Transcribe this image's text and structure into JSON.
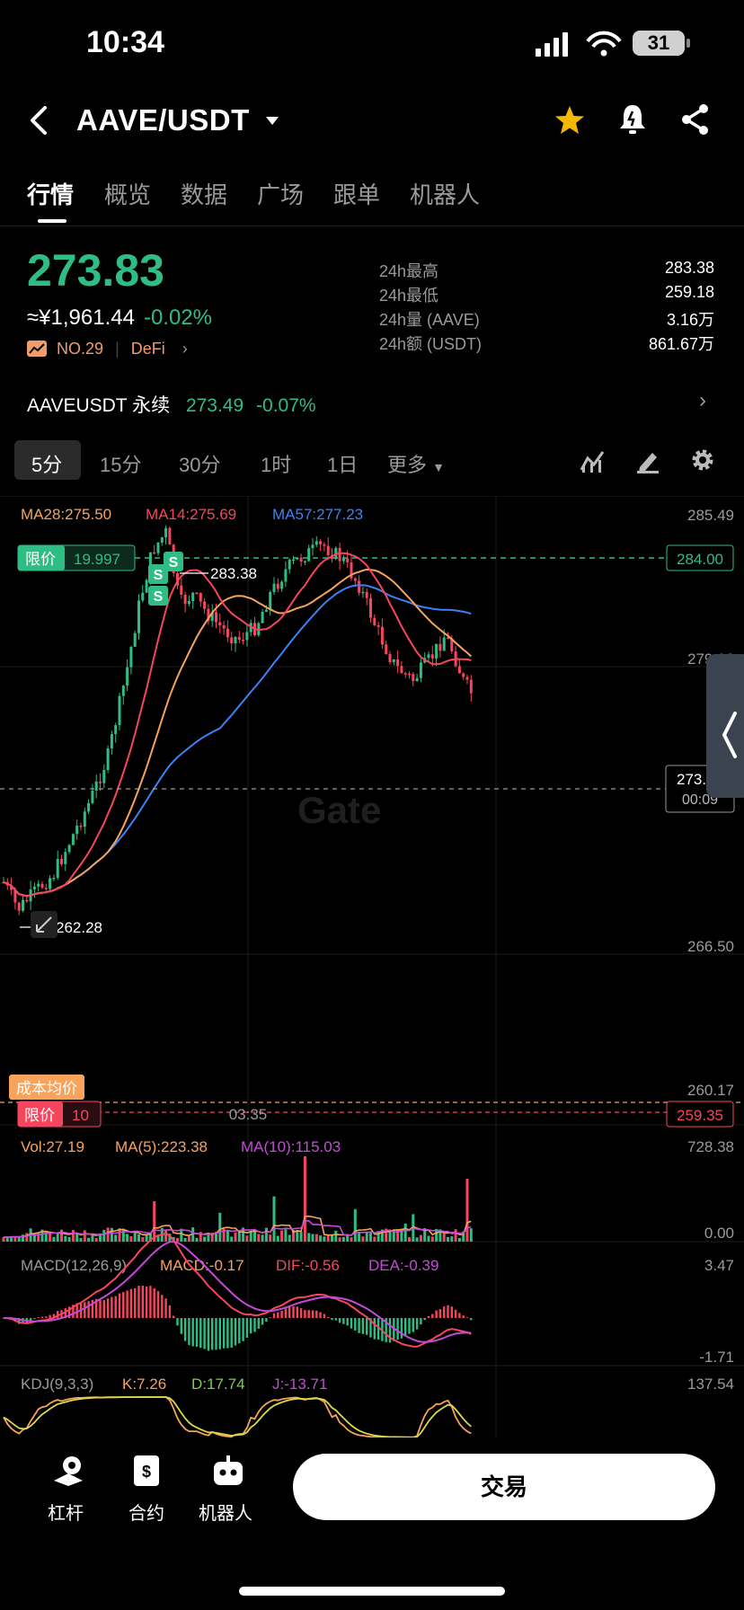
{
  "status": {
    "time": "10:34",
    "battery": "31"
  },
  "header": {
    "pair": "AAVE/USDT"
  },
  "tabs": [
    "行情",
    "概览",
    "数据",
    "广场",
    "跟单",
    "机器人"
  ],
  "ticker": {
    "price": "273.83",
    "cny": "≈¥1,961.44",
    "change": "-0.02%",
    "rank": "NO.29",
    "sector": "DeFi",
    "stats": [
      {
        "label": "24h最高",
        "value": "283.38"
      },
      {
        "label": "24h最低",
        "value": "259.18"
      },
      {
        "label": "24h量 (AAVE)",
        "value": "3.16万"
      },
      {
        "label": "24h额 (USDT)",
        "value": "861.67万"
      }
    ]
  },
  "perpetual": {
    "name": "AAVEUSDT 永续",
    "price": "273.49",
    "change": "-0.07%"
  },
  "intervals": [
    "5分",
    "15分",
    "30分",
    "1时",
    "1日",
    "更多"
  ],
  "main_chart": {
    "ma28": "MA28:275.50",
    "ma14": "MA14:275.69",
    "ma57": "MA57:277.23",
    "y_labels": [
      "285.49",
      "279.16",
      "266.50",
      "260.17"
    ],
    "limit_label": "限价",
    "limit_qty": "19.997",
    "limit_price": "284.00",
    "high_mark": "283.38",
    "low_mark": "262.28",
    "cur_price": "273.83",
    "countdown": "00:09",
    "cost_label": "成本均价",
    "limit2_label": "限价",
    "limit2_qty": "10",
    "limit2_price": "259.35",
    "x_label": "03:35",
    "marker": "S",
    "watermark": "Gate"
  },
  "vol_panel": {
    "vol": "Vol:27.19",
    "ma5": "MA(5):223.38",
    "ma10": "MA(10):115.03",
    "top": "728.38",
    "bottom": "0.00"
  },
  "macd_panel": {
    "title": "MACD(12,26,9)",
    "macd": "MACD:-0.17",
    "dif": "DIF:-0.56",
    "dea": "DEA:-0.39",
    "top": "3.47",
    "bottom": "-1.71"
  },
  "kdj_panel": {
    "title": "KDJ(9,3,3)",
    "k": "K:7.26",
    "d": "D:17.74",
    "j": "J:-13.71",
    "top": "137.54"
  },
  "bottom_nav": {
    "leverage": "杠杆",
    "contract": "合约",
    "robot": "机器人",
    "trade": "交易"
  },
  "colors": {
    "up": "#2ebd85",
    "down": "#f6465d",
    "ma28": "#f7a35c",
    "ma14": "#f6465d",
    "ma57": "#3b82f6",
    "accent": "#f5b800"
  }
}
